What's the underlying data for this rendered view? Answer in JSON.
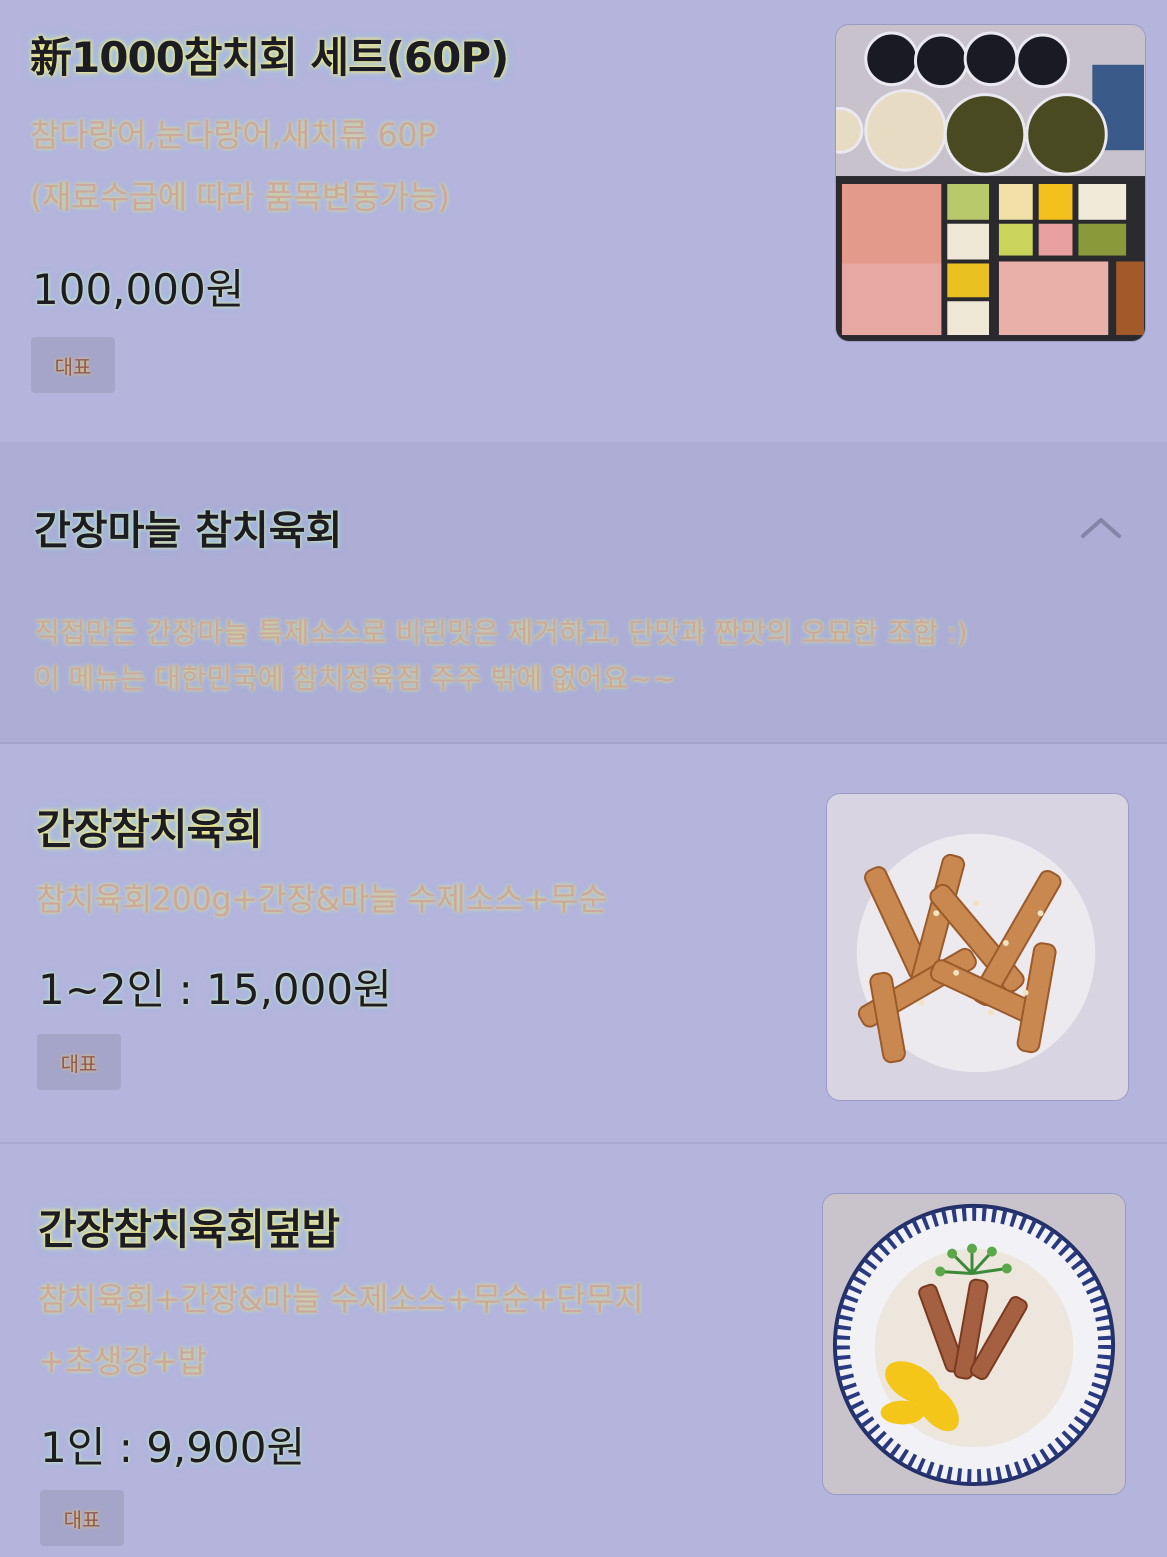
{
  "items": [
    {
      "name": "新1000참치회 세트(60P)",
      "desc_lines": [
        "참다랑어,눈다랑어,새치류 60P",
        "(재료수급에 따라 품목변동가능)"
      ],
      "price": "100,000원",
      "badge": "대표",
      "image_icon": "tuna-set-photo"
    },
    {
      "name": "간장참치육회",
      "desc_lines": [
        "참치육회200g+간장&마늘 수제소스+무순"
      ],
      "price": "1~2인 : 15,000원",
      "badge": "대표",
      "image_icon": "soy-tuna-yukhoe-photo"
    },
    {
      "name": "간장참치육회덮밥",
      "desc_lines": [
        "참치육회+간장&마늘 수제소스+무순+단무지",
        "+초생강+밥"
      ],
      "price": "1인 : 9,900원",
      "badge": "대표",
      "image_icon": "rice-bowl-photo"
    }
  ],
  "category": {
    "title": "간장마늘 참치육회",
    "desc_lines": [
      "직접만든 간장마늘 특제소스로 비린맛은 제거하고, 단맛과 짠맛의 오묘한 조합 :)",
      "이 메뉴는 대한민국에 참치정육점 주주 밖에 없어요~~"
    ],
    "toggle_icon": "chevron-up-icon"
  }
}
